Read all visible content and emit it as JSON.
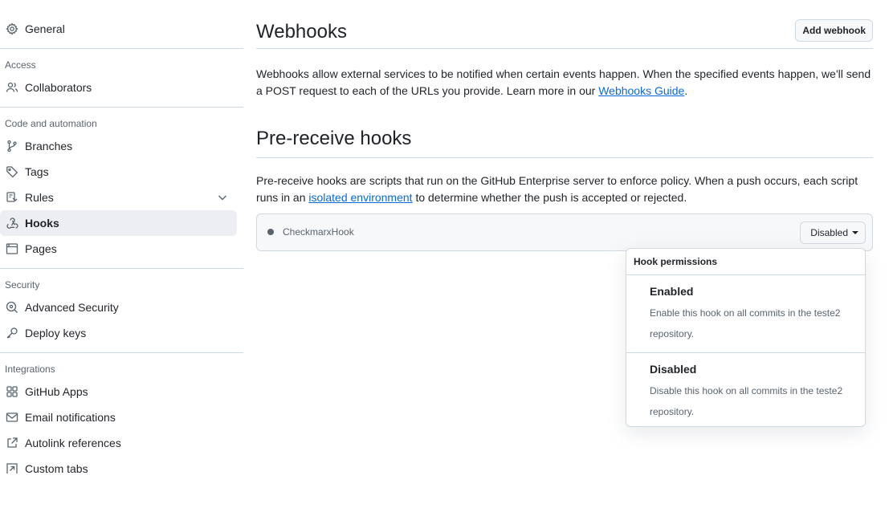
{
  "sidebar": {
    "general": "General",
    "groups": [
      {
        "heading": "Access",
        "items": [
          {
            "label": "Collaborators",
            "icon": "people-icon"
          }
        ]
      },
      {
        "heading": "Code and automation",
        "items": [
          {
            "label": "Branches",
            "icon": "branch-icon"
          },
          {
            "label": "Tags",
            "icon": "tag-icon"
          },
          {
            "label": "Rules",
            "icon": "rules-icon"
          },
          {
            "label": "Hooks",
            "icon": "webhook-icon"
          },
          {
            "label": "Pages",
            "icon": "browser-icon"
          }
        ]
      },
      {
        "heading": "Security",
        "items": [
          {
            "label": "Advanced Security",
            "icon": "codescan-icon"
          },
          {
            "label": "Deploy keys",
            "icon": "key-icon"
          }
        ]
      },
      {
        "heading": "Integrations",
        "items": [
          {
            "label": "GitHub Apps",
            "icon": "apps-icon"
          },
          {
            "label": "Email notifications",
            "icon": "mail-icon"
          },
          {
            "label": "Autolink references",
            "icon": "link-external-icon"
          },
          {
            "label": "Custom tabs",
            "icon": "custom-tab-icon"
          }
        ]
      }
    ]
  },
  "webhooks": {
    "title": "Webhooks",
    "add_button": "Add webhook",
    "description": "Webhooks allow external services to be notified when certain events happen. When the specified events happen, we'll send a POST request to each of the URLs you provide. Learn more in our ",
    "link": "Webhooks Guide",
    "description_end": "."
  },
  "prereceive": {
    "title": "Pre-receive hooks",
    "description": "Pre-receive hooks are scripts that run on the GitHub Enterprise server to enforce policy. When a push occurs, each script runs in an ",
    "link": "isolated environment",
    "description_end": " to determine whether the push is accepted or rejected.",
    "hook_name": "CheckmarxHook",
    "status": "Disabled"
  },
  "menu": {
    "heading": "Hook permissions",
    "options": [
      {
        "title": "Enabled",
        "desc": "Enable this hook on all commits in the teste2 repository."
      },
      {
        "title": "Disabled",
        "desc": "Disable this hook on all commits in the teste2 repository."
      }
    ]
  }
}
